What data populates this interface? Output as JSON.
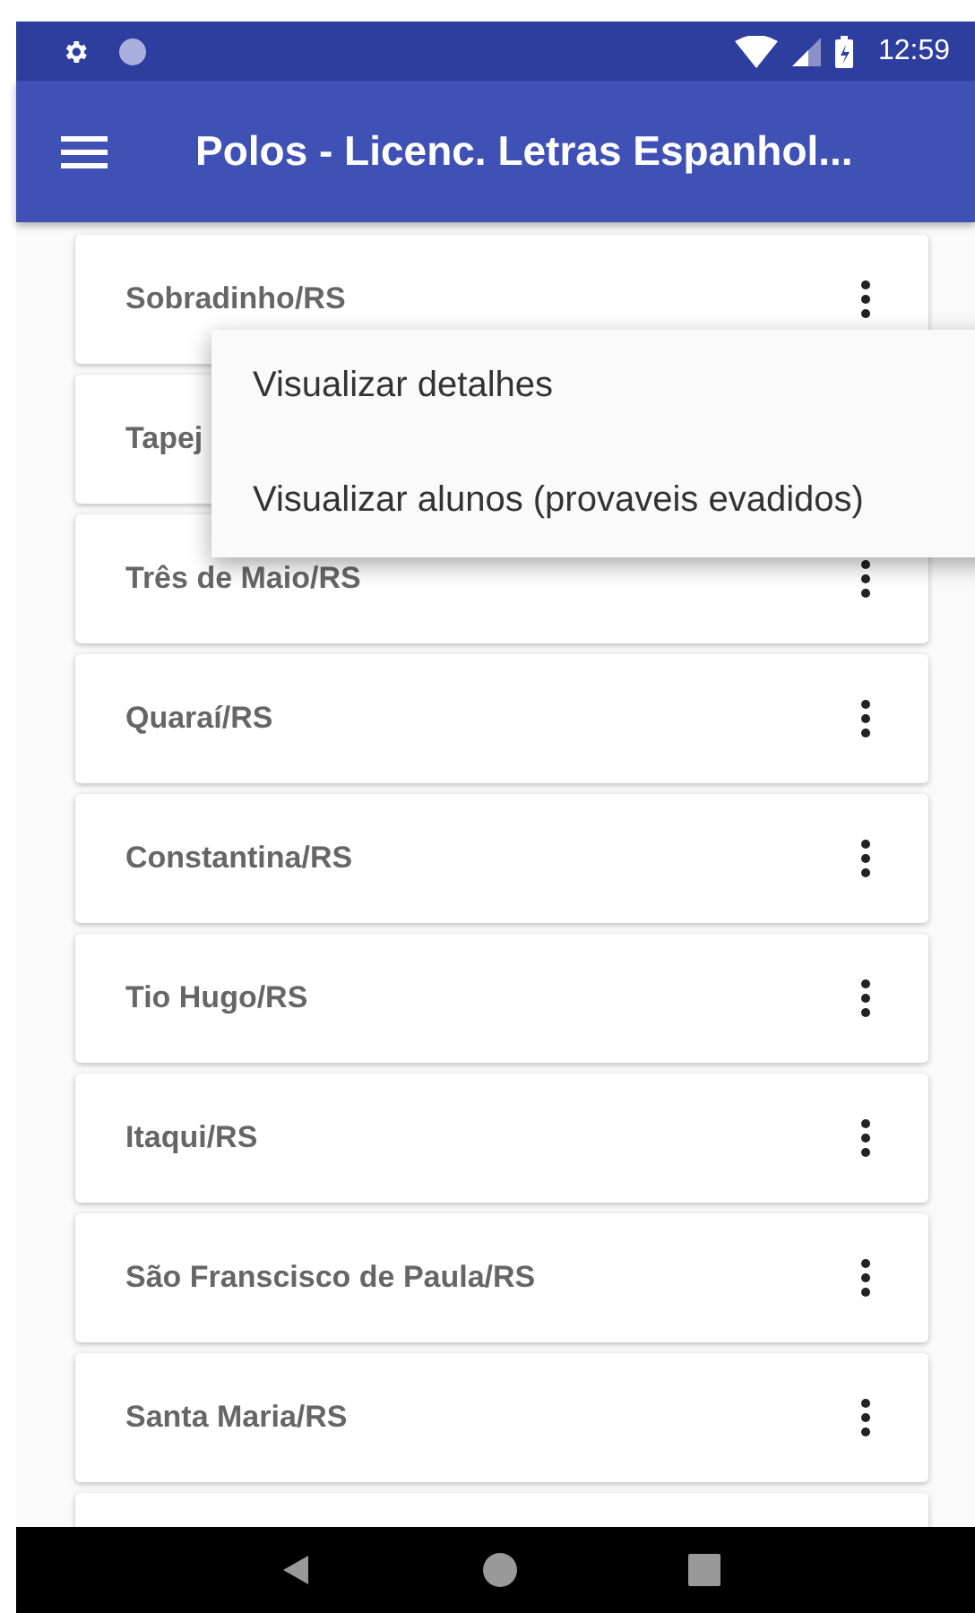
{
  "status_bar": {
    "time": "12:59"
  },
  "app_bar": {
    "title": "Polos - Licenc. Letras Espanhol..."
  },
  "items": [
    {
      "label": "Sobradinho/RS",
      "menu_open": true
    },
    {
      "label": "Tapej",
      "menu_open": false
    },
    {
      "label": "Três de Maio/RS",
      "menu_open": false
    },
    {
      "label": "Quaraí/RS",
      "menu_open": false
    },
    {
      "label": "Constantina/RS",
      "menu_open": false
    },
    {
      "label": "Tio Hugo/RS",
      "menu_open": false
    },
    {
      "label": "Itaqui/RS",
      "menu_open": false
    },
    {
      "label": "São Franscisco de Paula/RS",
      "menu_open": false
    },
    {
      "label": "Santa Maria/RS",
      "menu_open": false
    }
  ],
  "popup_menu": {
    "items": [
      "Visualizar detalhes",
      "Visualizar alunos (provaveis evadidos)"
    ]
  }
}
